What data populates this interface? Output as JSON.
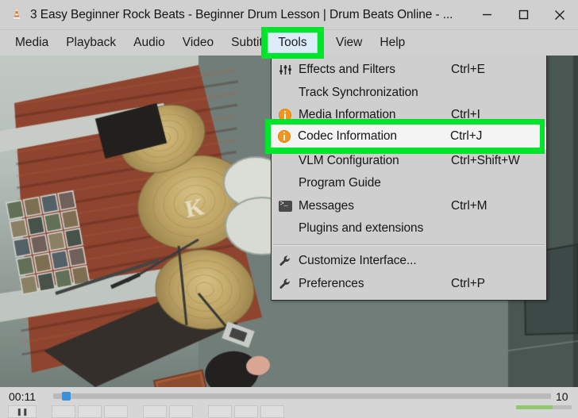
{
  "window": {
    "app_icon": "vlc-cone-icon",
    "title": "3 Easy Beginner Rock Beats - Beginner Drum Lesson | Drum Beats Online - ...",
    "minimize_label": "minimize-icon",
    "maximize_label": "maximize-icon",
    "close_label": "close-icon"
  },
  "menubar": {
    "items": [
      {
        "label": "Media",
        "active": false
      },
      {
        "label": "Playback",
        "active": false
      },
      {
        "label": "Audio",
        "active": false
      },
      {
        "label": "Video",
        "active": false
      },
      {
        "label": "Subtitle",
        "active": false
      },
      {
        "label": "Tools",
        "active": true
      },
      {
        "label": "View",
        "active": false
      },
      {
        "label": "Help",
        "active": false
      }
    ]
  },
  "tools_menu": {
    "items": [
      {
        "label": "Effects and Filters",
        "shortcut": "Ctrl+E",
        "icon": "equalizer-icon",
        "selected": false,
        "separator_before": false
      },
      {
        "label": "Track Synchronization",
        "shortcut": "",
        "icon": "",
        "selected": false,
        "separator_before": false
      },
      {
        "label": "Media Information",
        "shortcut": "Ctrl+I",
        "icon": "info-icon",
        "selected": false,
        "separator_before": false
      },
      {
        "label": "Codec Information",
        "shortcut": "Ctrl+J",
        "icon": "info-icon",
        "selected": true,
        "separator_before": false
      },
      {
        "label": "VLM Configuration",
        "shortcut": "Ctrl+Shift+W",
        "icon": "",
        "selected": false,
        "separator_before": false
      },
      {
        "label": "Program Guide",
        "shortcut": "",
        "icon": "",
        "selected": false,
        "separator_before": false
      },
      {
        "label": "Messages",
        "shortcut": "Ctrl+M",
        "icon": "terminal-icon",
        "selected": false,
        "separator_before": false
      },
      {
        "label": "Plugins and extensions",
        "shortcut": "",
        "icon": "",
        "selected": false,
        "separator_before": false
      },
      {
        "label": "Customize Interface...",
        "shortcut": "",
        "icon": "wrench-icon",
        "selected": false,
        "separator_before": true
      },
      {
        "label": "Preferences",
        "shortcut": "Ctrl+P",
        "icon": "wrench-icon",
        "selected": false,
        "separator_before": false
      }
    ]
  },
  "highlights": {
    "accent_color": "#00e529",
    "tools_label": "Tools",
    "codec_label": "Codec Information",
    "codec_shortcut": "Ctrl+J"
  },
  "playback": {
    "time_elapsed": "00:11",
    "time_total": "10",
    "seek_position_percent": 2,
    "volume_percent": 66
  },
  "controls": {
    "buttons": [
      {
        "name": "play-pause-button",
        "glyph": "❚❚"
      },
      {
        "name": "previous-button",
        "glyph": ""
      },
      {
        "name": "stop-button",
        "glyph": ""
      },
      {
        "name": "next-button",
        "glyph": ""
      },
      {
        "name": "fullscreen-button",
        "glyph": ""
      },
      {
        "name": "extended-settings-button",
        "glyph": ""
      },
      {
        "name": "playlist-button",
        "glyph": ""
      },
      {
        "name": "loop-button",
        "glyph": ""
      },
      {
        "name": "random-button",
        "glyph": ""
      }
    ]
  }
}
